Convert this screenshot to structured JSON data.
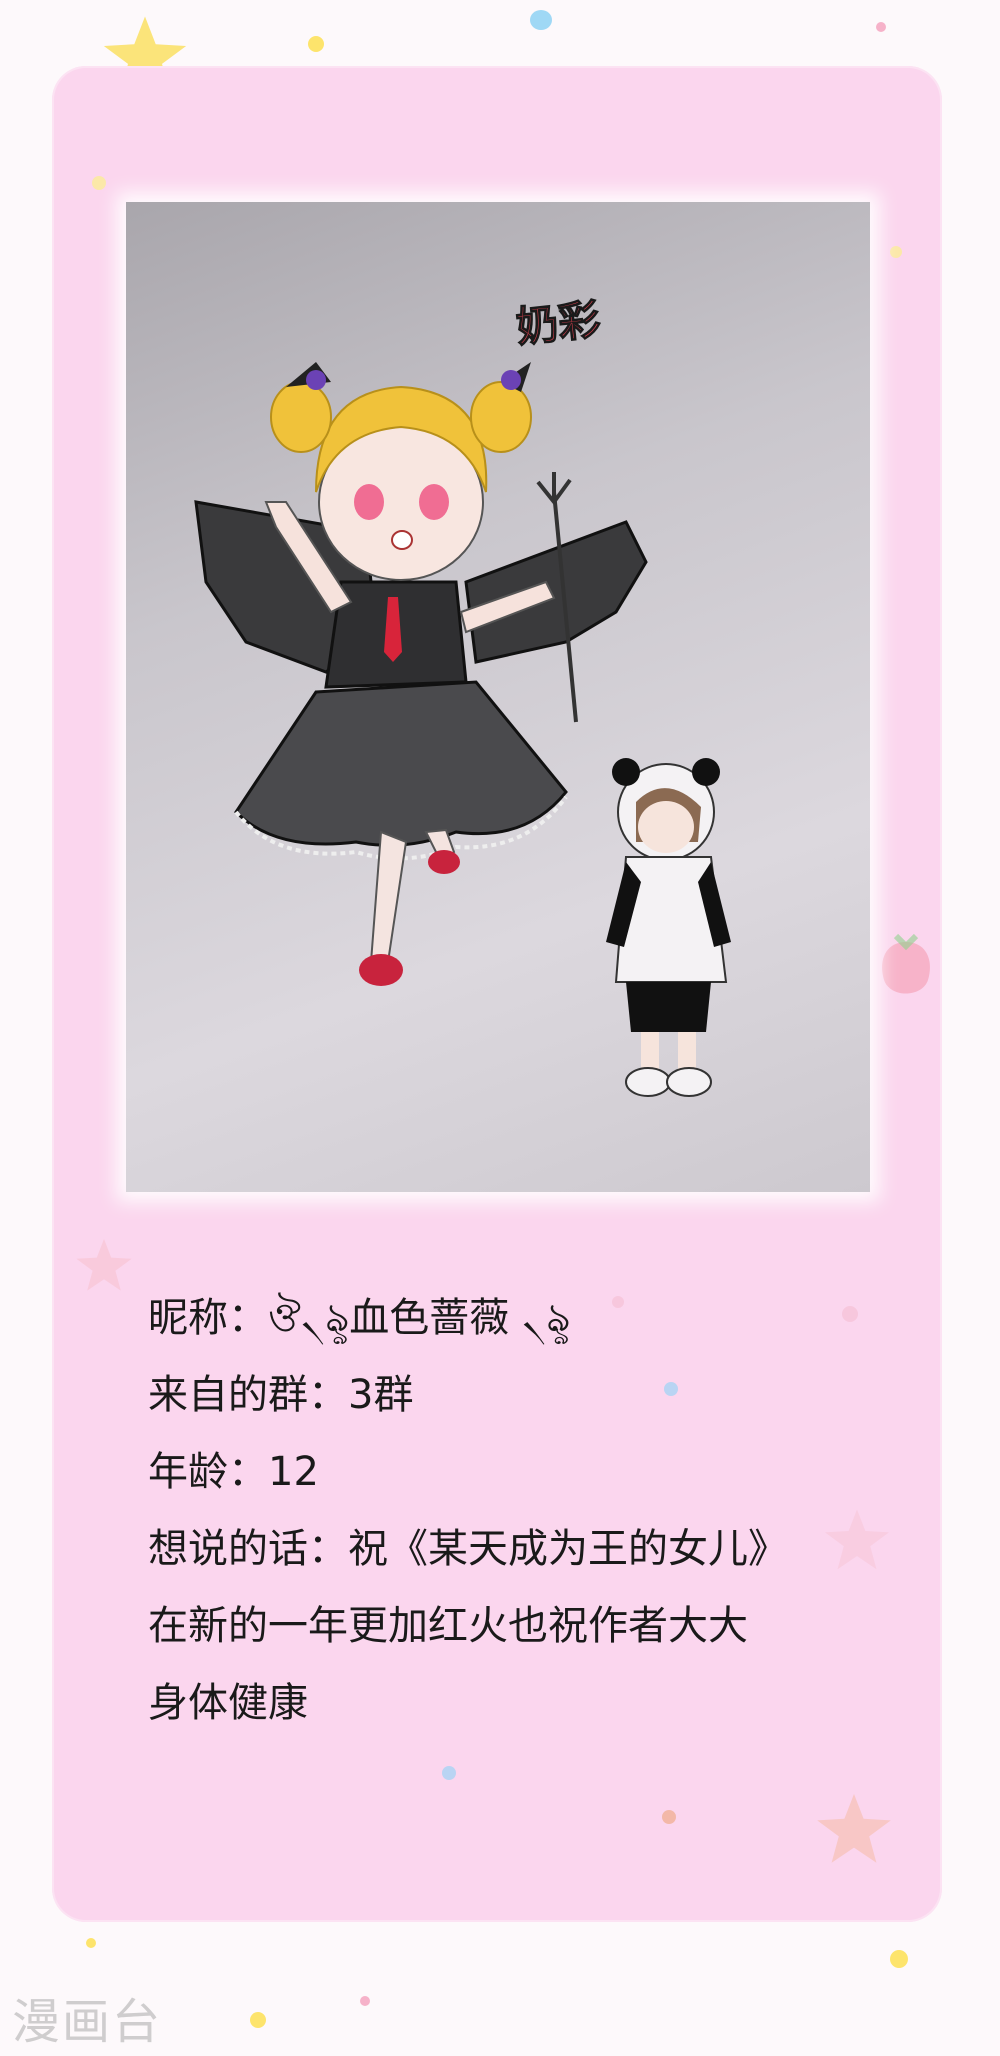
{
  "card": {
    "drawing": {
      "signature": "奶彩",
      "description_icons": [
        "devil-girl-drawing",
        "panda-boy-drawing"
      ]
    },
    "info": {
      "nickname_label": "昵称：",
      "nickname_value": "ঔ৲ৡ血色蔷薇 ৲ৡ",
      "group_label": "来自的群：",
      "group_value": "3群",
      "age_label": "年龄：",
      "age_value": "12",
      "message_label": "想说的话：",
      "message_line1": "祝《某天成为王的女儿》",
      "message_line2": "在新的一年更加红火也祝作者大大",
      "message_line3": "身体健康"
    }
  },
  "watermark": "漫画台",
  "colors": {
    "card": "#fbd6ee",
    "background": "#fdf9fb",
    "text": "#1a1a1a"
  }
}
